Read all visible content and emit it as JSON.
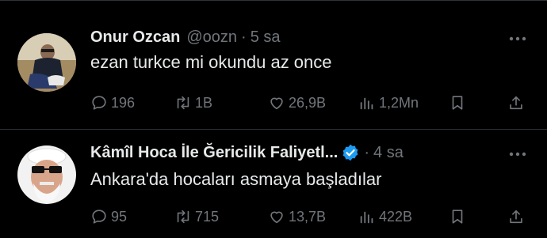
{
  "tweets": [
    {
      "name": "Onur Ozcan",
      "handle": "@oozn",
      "separator": "·",
      "time": "5 sa",
      "text": "ezan turkce mi okundu az once",
      "replies": "196",
      "retweets": "1B",
      "likes": "26,9B",
      "views": "1,2Mn",
      "verified": false
    },
    {
      "name": "Kâmîl Hoca İle Ğericilik Faliyetl...",
      "separator": "·",
      "time": "4 sa",
      "text": "Ankara'da hocaları asmaya başladılar",
      "replies": "95",
      "retweets": "715",
      "likes": "13,7B",
      "views": "422B",
      "verified": true
    }
  ],
  "colors": {
    "background": "#000000",
    "text": "#e7e9ea",
    "muted": "#71767b",
    "verified": "#1d9bf0",
    "divider": "#2f3336"
  },
  "icons": [
    "reply-icon",
    "retweet-icon",
    "like-icon",
    "views-icon",
    "bookmark-icon",
    "share-icon",
    "more-icon",
    "verified-badge-icon"
  ]
}
